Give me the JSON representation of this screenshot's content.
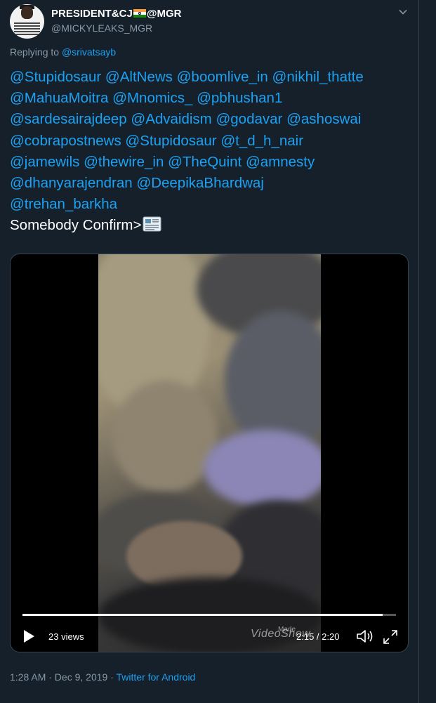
{
  "tweet": {
    "author": {
      "display_name_prefix": "PRESIDENT&CJ",
      "display_name_suffix": "@MGR",
      "handle": "@MICKYLEAKS_MGR",
      "avatar_text": [
        "MICHAEL JOHN EMMANUEL",
        "PRESIDENT & CHIEF JUSTICE",
        "SUPREME COURT OF INDIA",
        "GLOBAL HUMAN RIGHTS",
        "& PEACE",
        "MR. MGR"
      ]
    },
    "replying_label": "Replying to ",
    "replying_to": "@srivatsayb",
    "mentions": [
      "@Stupidosaur",
      "@AltNews",
      "@boomlive_in",
      "@nikhil_thatte",
      "@MahuaMoitra",
      "@Mnomics_",
      "@pbhushan1",
      "@sardesairajdeep",
      "@Advaidism",
      "@godavar",
      "@ashoswai",
      "@cobrapostnews",
      "@Stupidosaur",
      "@t_d_h_nair",
      "@jamewils",
      "@thewire_in",
      "@TheQuint",
      "@amnesty",
      "@dhanyarajendran",
      "@DeepikaBhardwaj",
      "@trehan_barkha"
    ],
    "body_text": "Somebody Confirm>",
    "emoji": "newspaper",
    "video": {
      "views": "23 views",
      "time": "2:15 / 2:20",
      "progress": 0.964,
      "watermark_small": "Made",
      "watermark": "VideoShow"
    },
    "timestamp": "1:28 AM · Dec 9, 2019",
    "separator": " · ",
    "source": "Twitter for Android"
  },
  "colors": {
    "background": "#15202b",
    "link": "#1da1f2",
    "secondary": "#8899a6"
  },
  "icons": [
    "chevron-down-icon",
    "newspaper-icon",
    "play-icon",
    "volume-icon",
    "fullscreen-icon",
    "india-flag-icon"
  ]
}
